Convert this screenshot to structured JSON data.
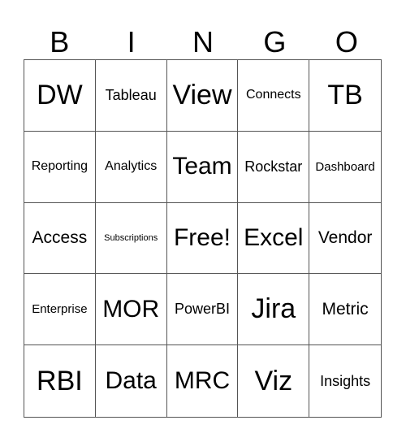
{
  "header": [
    "B",
    "I",
    "N",
    "G",
    "O"
  ],
  "cells": [
    {
      "text": "DW",
      "size": "s-xl"
    },
    {
      "text": "Tableau",
      "size": "s-s"
    },
    {
      "text": "View",
      "size": "s-xl"
    },
    {
      "text": "Connects",
      "size": "s-xs"
    },
    {
      "text": "TB",
      "size": "s-xl"
    },
    {
      "text": "Reporting",
      "size": "s-xs"
    },
    {
      "text": "Analytics",
      "size": "s-xs"
    },
    {
      "text": "Team",
      "size": "s-l"
    },
    {
      "text": "Rockstar",
      "size": "s-s"
    },
    {
      "text": "Dashboard",
      "size": "s-xxs"
    },
    {
      "text": "Access",
      "size": "s-m"
    },
    {
      "text": "Subscriptions",
      "size": "s-tiny"
    },
    {
      "text": "Free!",
      "size": "s-l"
    },
    {
      "text": "Excel",
      "size": "s-l"
    },
    {
      "text": "Vendor",
      "size": "s-m"
    },
    {
      "text": "Enterprise",
      "size": "s-xxs"
    },
    {
      "text": "MOR",
      "size": "s-l"
    },
    {
      "text": "PowerBI",
      "size": "s-s"
    },
    {
      "text": "Jira",
      "size": "s-xl"
    },
    {
      "text": "Metric",
      "size": "s-m"
    },
    {
      "text": "RBI",
      "size": "s-xl"
    },
    {
      "text": "Data",
      "size": "s-l"
    },
    {
      "text": "MRC",
      "size": "s-l"
    },
    {
      "text": "Viz",
      "size": "s-xl"
    },
    {
      "text": "Insights",
      "size": "s-s"
    }
  ]
}
